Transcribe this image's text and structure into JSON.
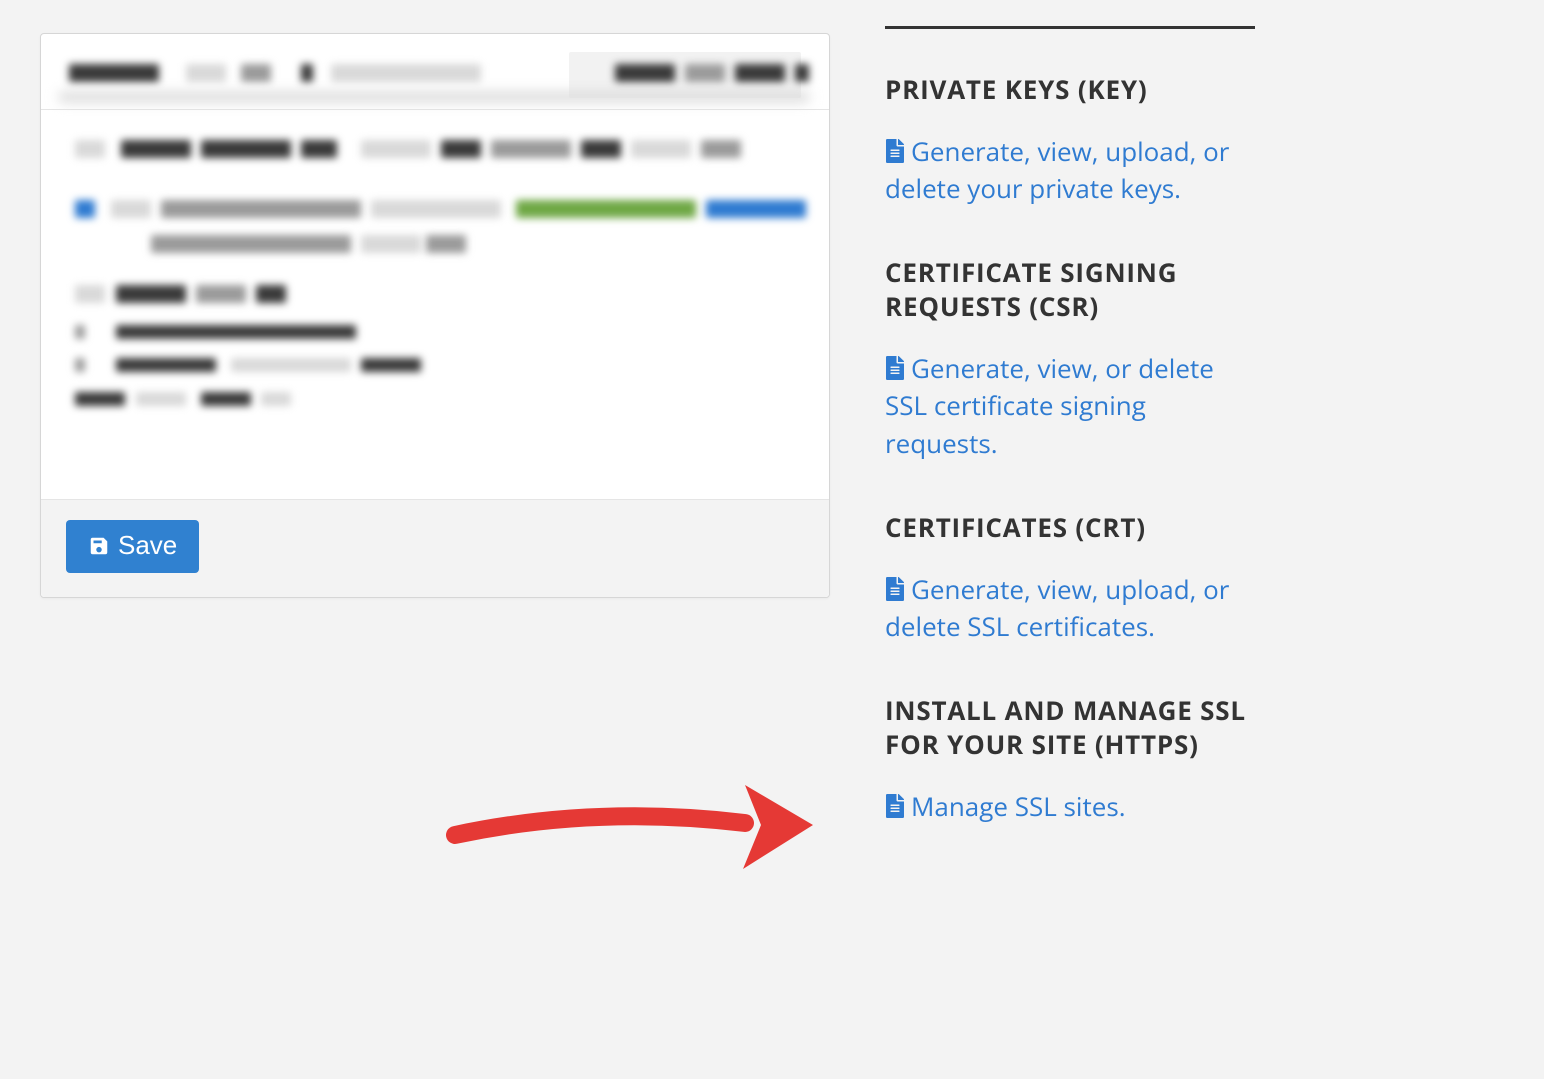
{
  "buttons": {
    "save": "Save"
  },
  "sidebar": {
    "sections": [
      {
        "heading": "PRIVATE KEYS (KEY)",
        "link": "Generate, view, upload, or delete your private keys."
      },
      {
        "heading": "CERTIFICATE SIGNING REQUESTS (CSR)",
        "link": "Generate, view, or delete SSL certificate signing requests."
      },
      {
        "heading": "CERTIFICATES (CRT)",
        "link": "Generate, view, upload, or delete SSL certificates."
      },
      {
        "heading": "INSTALL AND MANAGE SSL FOR YOUR SITE (HTTPS)",
        "link": "Manage SSL sites."
      }
    ]
  }
}
